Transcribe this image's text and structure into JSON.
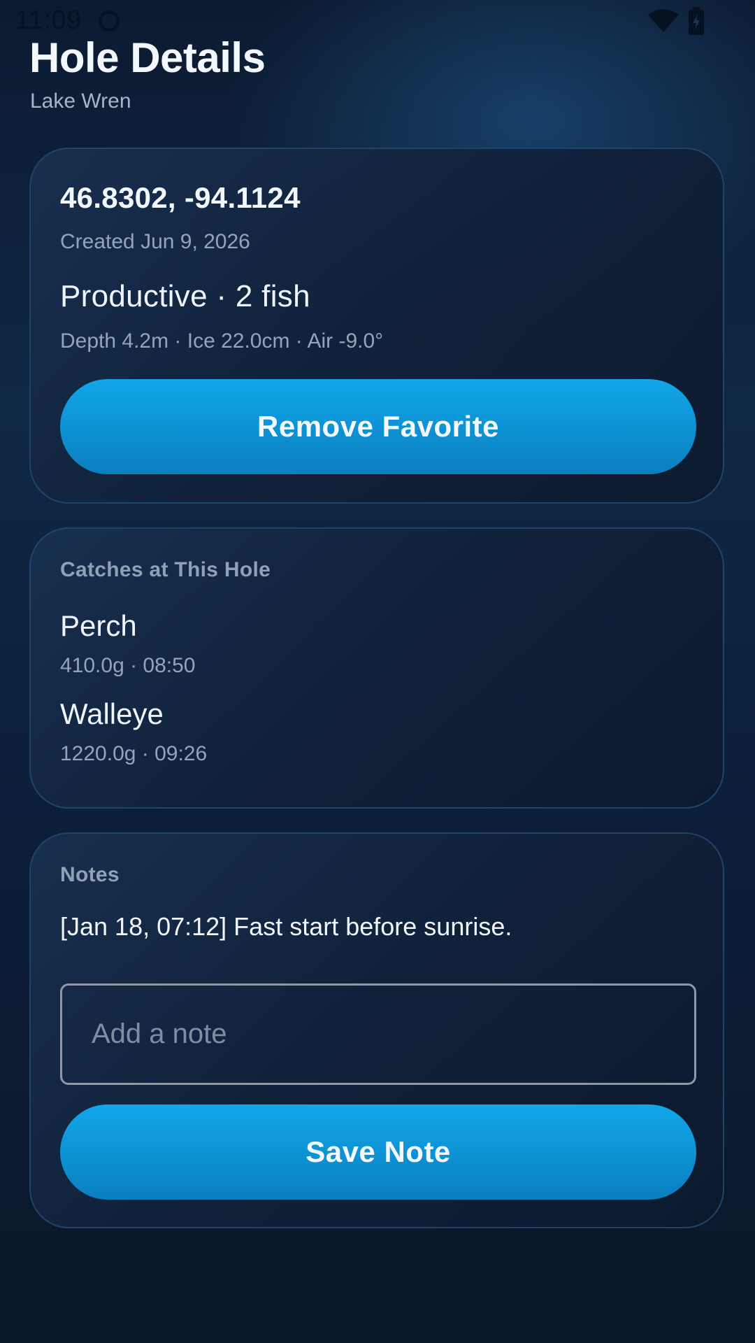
{
  "status_bar": {
    "time": "11:09",
    "icons": [
      "sync-icon",
      "wifi-icon",
      "battery-icon"
    ]
  },
  "header": {
    "title": "Hole Details",
    "subtitle": "Lake Wren"
  },
  "hole": {
    "coordinates": "46.8302, -94.1124",
    "created": "Created Jun 9, 2026",
    "status": "Productive · 2 fish",
    "conditions": "Depth 4.2m · Ice 22.0cm · Air -9.0°",
    "favorite_button": "Remove Favorite"
  },
  "catches": {
    "heading": "Catches at This Hole",
    "items": [
      {
        "species": "Perch",
        "detail": "410.0g · 08:50"
      },
      {
        "species": "Walleye",
        "detail": "1220.0g · 09:26"
      }
    ]
  },
  "notes": {
    "heading": "Notes",
    "entries": [
      "[Jan 18, 07:12] Fast start before sunrise."
    ],
    "input_placeholder": "Add a note",
    "input_value": "",
    "save_button": "Save Note"
  },
  "colors": {
    "accent": "#10a7e9",
    "accent_dark": "#0a7fc0",
    "background": "#0f2846",
    "card_border": "#1f4468",
    "text_primary": "#eef4fb",
    "text_secondary": "#93a5b9"
  }
}
